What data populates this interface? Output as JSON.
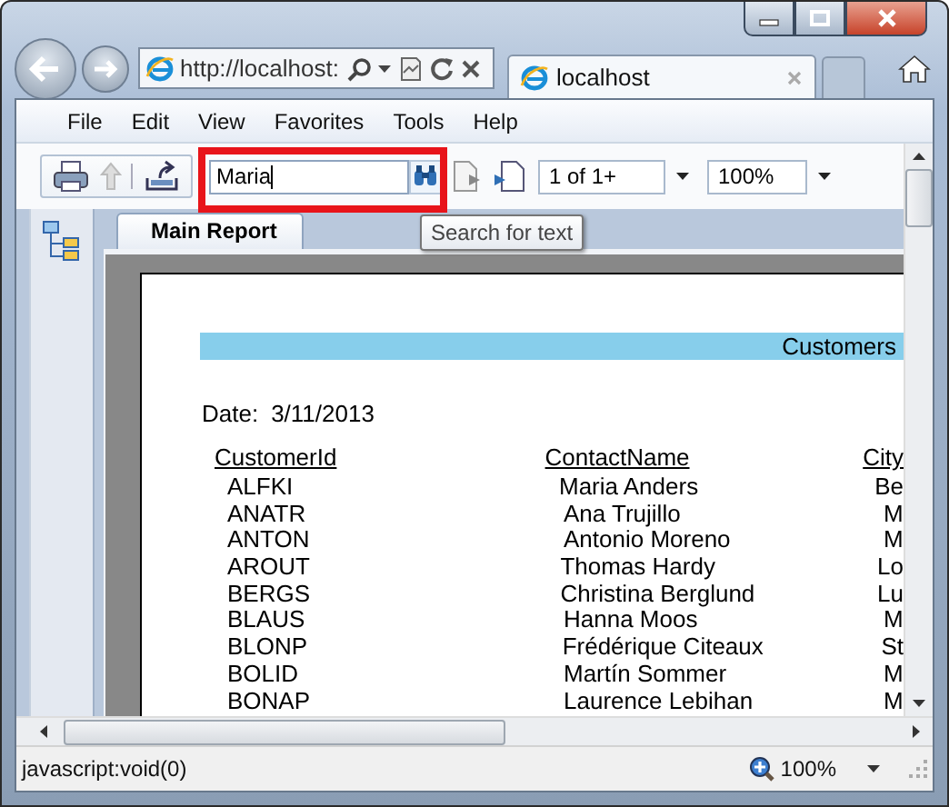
{
  "browser": {
    "address": "http://localhost:",
    "tab": {
      "title": "localhost",
      "selected": true
    }
  },
  "menu": [
    "File",
    "Edit",
    "View",
    "Favorites",
    "Tools",
    "Help"
  ],
  "toolbar": {
    "search": {
      "value": "Maria",
      "highlighted": true
    },
    "page": "1 of 1+",
    "zoom": "100%"
  },
  "tooltip": "Search for text",
  "report_tabs": [
    {
      "label": "Main Report",
      "selected": true
    }
  ],
  "report": {
    "title": "Customers",
    "date_label": "Date:",
    "date": "3/11/2013",
    "columns": [
      "CustomerId",
      "ContactName",
      "City"
    ],
    "rows": [
      [
        "ALFKI",
        "Maria Anders",
        "Be"
      ],
      [
        "ANATR",
        "Ana Trujillo",
        "M"
      ],
      [
        "ANTON",
        "Antonio Moreno",
        "M"
      ],
      [
        "AROUT",
        "Thomas Hardy",
        "Lo"
      ],
      [
        "BERGS",
        "Christina Berglund",
        "Lu"
      ],
      [
        "BLAUS",
        "Hanna Moos",
        "M"
      ],
      [
        "BLONP",
        "Frédérique Citeaux",
        "St"
      ],
      [
        "BOLID",
        "Martín Sommer",
        "M"
      ],
      [
        "BONAP",
        "Laurence Lebihan",
        "M"
      ]
    ]
  },
  "status_bar": {
    "text": "javascript:void(0)",
    "zoom": "100%"
  }
}
